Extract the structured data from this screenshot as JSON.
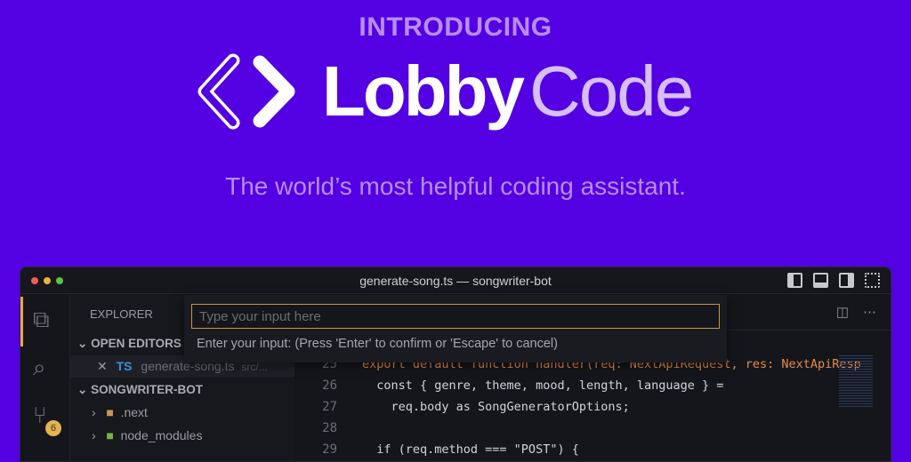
{
  "hero": {
    "intro": "INTRODUCING",
    "brand_bold": "Lobby",
    "brand_light": "Code",
    "tagline": "The world’s most helpful coding assistant."
  },
  "window": {
    "title": "generate-song.ts — songwriter-bot"
  },
  "activity": {
    "badge": "6"
  },
  "sidebar": {
    "explorer": "EXPLORER",
    "open_editors": "OPEN EDITORS",
    "open_file": {
      "lang": "TS",
      "name": "generate-song.ts",
      "path": "src/..."
    },
    "project": "SONGWRITER-BOT",
    "items": [
      ".next",
      "node_modules"
    ]
  },
  "quick_input": {
    "placeholder": "Type your input here",
    "value": "",
    "hint": "Enter your input: (Press 'Enter' to confirm or 'Escape' to cancel)"
  },
  "editor": {
    "lines": [
      {
        "n": "25",
        "code": "export default function handler(req: NextApiRequest, res: NextApiResp"
      },
      {
        "n": "26",
        "code": "  const { genre, theme, mood, length, language } ="
      },
      {
        "n": "27",
        "code": "    req.body as SongGeneratorOptions;"
      },
      {
        "n": "28",
        "code": ""
      },
      {
        "n": "29",
        "code": "  if (req.method === \"POST\") {"
      }
    ]
  },
  "colors": {
    "background": "#5300e2",
    "accent": "#f0a442"
  }
}
